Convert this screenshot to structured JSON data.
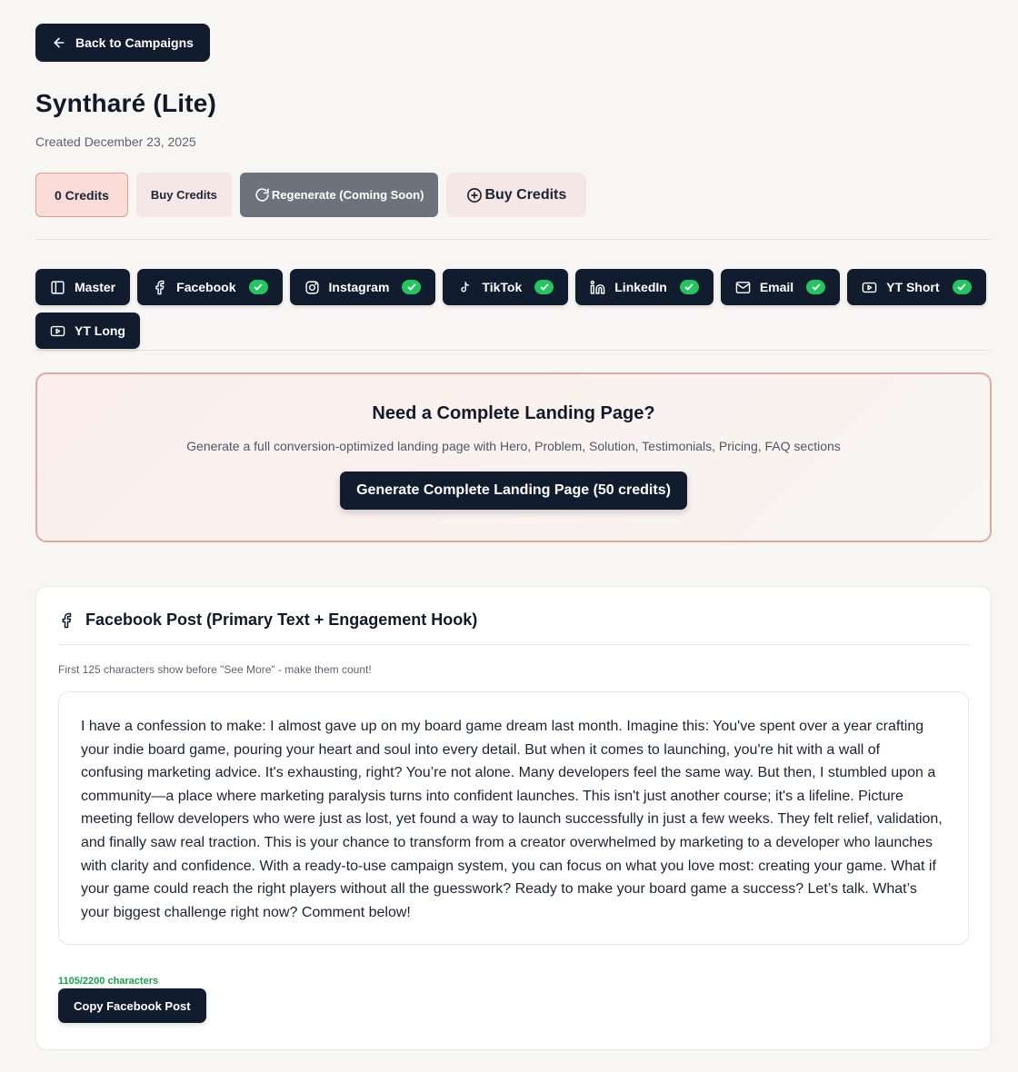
{
  "nav": {
    "back_label": "Back to Campaigns"
  },
  "campaign": {
    "title": "Syntharé (Lite)",
    "created": "Created December 23, 2025"
  },
  "actions": {
    "credits": "0 Credits",
    "buy_small": "Buy Credits",
    "regenerate": "Regenerate (Coming Soon)",
    "buy_big": "Buy Credits"
  },
  "tabs": [
    {
      "label": "Master",
      "icon": "sidebar-icon",
      "done": false
    },
    {
      "label": "Facebook",
      "icon": "facebook-icon",
      "done": true
    },
    {
      "label": "Instagram",
      "icon": "instagram-icon",
      "done": true
    },
    {
      "label": "TikTok",
      "icon": "tiktok-icon",
      "done": true
    },
    {
      "label": "LinkedIn",
      "icon": "linkedin-icon",
      "done": true
    },
    {
      "label": "Email",
      "icon": "mail-icon",
      "done": true
    },
    {
      "label": "YT Short",
      "icon": "youtube-icon",
      "done": true
    },
    {
      "label": "YT Long",
      "icon": "youtube-icon",
      "done": false
    }
  ],
  "landing": {
    "title": "Need a Complete Landing Page?",
    "description": "Generate a full conversion-optimized landing page with Hero, Problem, Solution, Testimonials, Pricing, FAQ sections",
    "button": "Generate Complete Landing Page (50 credits)"
  },
  "post": {
    "title": "Facebook Post (Primary Text + Engagement Hook)",
    "hint": "First 125 characters show before \"See More\" - make them count!",
    "text": "I have a confession to make: I almost gave up on my board game dream last month. Imagine this: You've spent over a year crafting your indie board game, pouring your heart and soul into every detail. But when it comes to launching, you're hit with a wall of confusing marketing advice. It's exhausting, right? You’re not alone. Many developers feel the same way. But then, I stumbled upon a community—a place where marketing paralysis turns into confident launches. This isn't just another course; it's a lifeline. Picture meeting fellow developers who were just as lost, yet found a way to launch successfully in just a few weeks. They felt relief, validation, and finally saw real traction. This is your chance to transform from a creator overwhelmed by marketing to a developer who launches with clarity and confidence. With a ready-to-use campaign system, you can focus on what you love most: creating your game. What if your game could reach the right players without all the guesswork? Ready to make your board game a success? Let’s talk. What’s your biggest challenge right now? Comment below!",
    "char_count": "1105/2200 characters",
    "copy_label": "Copy Facebook Post"
  },
  "colors": {
    "primary": "#111c2e",
    "accent_red": "#e79a93",
    "success": "#22c55e",
    "background": "#f7f6f3"
  }
}
